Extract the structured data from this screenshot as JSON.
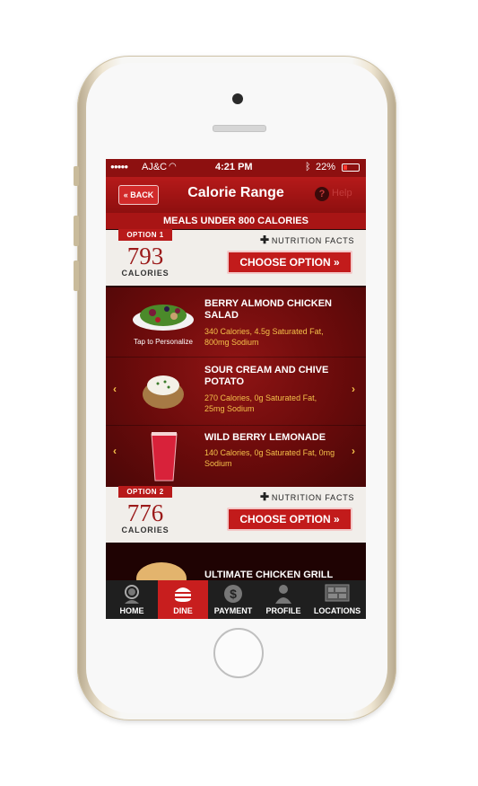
{
  "status_bar": {
    "carrier": "AJ&C",
    "time": "4:21 PM",
    "battery": "22%"
  },
  "nav": {
    "back_label": "« BACK",
    "title": "Calorie Range",
    "help_label": "Help"
  },
  "banner": "MEALS UNDER 800 CALORIES",
  "options": [
    {
      "tag": "OPTION 1",
      "calories": "793",
      "calories_label": "CALORIES",
      "nutrition_label": "NUTRITION FACTS",
      "choose_label": "CHOOSE OPTION »",
      "items": [
        {
          "name": "BERRY ALMOND CHICKEN SALAD",
          "desc": "340 Calories, 4.5g Saturated Fat, 800mg Sodium",
          "hint": "Tap to Personalize"
        },
        {
          "name": "SOUR CREAM AND CHIVE POTATO",
          "desc": "270 Calories, 0g Saturated Fat, 25mg Sodium"
        },
        {
          "name": "WILD BERRY LEMONADE",
          "desc": "140 Calories, 0g Saturated Fat, 0mg Sodium"
        }
      ]
    },
    {
      "tag": "OPTION 2",
      "calories": "776",
      "calories_label": "CALORIES",
      "nutrition_label": "NUTRITION FACTS",
      "choose_label": "CHOOSE OPTION »",
      "items": [
        {
          "name": "ULTIMATE CHICKEN GRILL"
        }
      ]
    }
  ],
  "tabs": [
    {
      "label": "HOME",
      "icon": "wendy-icon"
    },
    {
      "label": "DINE",
      "icon": "burger-icon",
      "active": true
    },
    {
      "label": "PAYMENT",
      "icon": "dollar-icon"
    },
    {
      "label": "PROFILE",
      "icon": "person-icon"
    },
    {
      "label": "LOCATIONS",
      "icon": "map-icon"
    }
  ],
  "colors": {
    "brand_red": "#c21b1b",
    "accent_gold": "#f4c04a",
    "dark_bg": "#2a0505"
  }
}
